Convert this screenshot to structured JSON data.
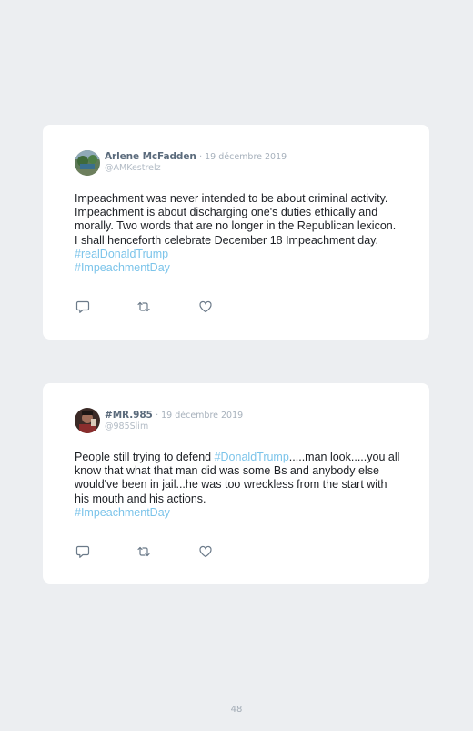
{
  "page_number": "48",
  "colors": {
    "background": "#eceef1",
    "card": "#ffffff",
    "hashtag": "#7cc4ea",
    "name": "#5b6b7c",
    "meta": "#a7b1bc",
    "icon": "#6b7a89"
  },
  "tweets": [
    {
      "author_name": "Arlene McFadden",
      "date": "· 19 décembre 2019",
      "handle": "@AMKestrelz",
      "text": "Impeachment was never intended to be about criminal activity. Impeachment is about discharging one's duties ethically and morally. Two words that are no longer in the Republican lexicon. I shall henceforth celebrate December 18 Impeachment day.",
      "hashtags": [
        "#realDonaldTrump",
        "#ImpeachmentDay"
      ],
      "icons": [
        "reply-icon",
        "retweet-icon",
        "like-icon"
      ]
    },
    {
      "author_name": "#MR.985",
      "date": "· 19 décembre 2019",
      "handle": "@985Slim",
      "text_before": "People still trying to defend",
      "inline_hashtag": "#DonaldTrump",
      "text_after": ".....man look.....you all know that what that man did was some Bs and anybody else would've been in jail...he was too wreckless from the start with his mouth and his actions.",
      "hashtags": [
        "#ImpeachmentDay"
      ],
      "icons": [
        "reply-icon",
        "retweet-icon",
        "like-icon"
      ]
    }
  ]
}
